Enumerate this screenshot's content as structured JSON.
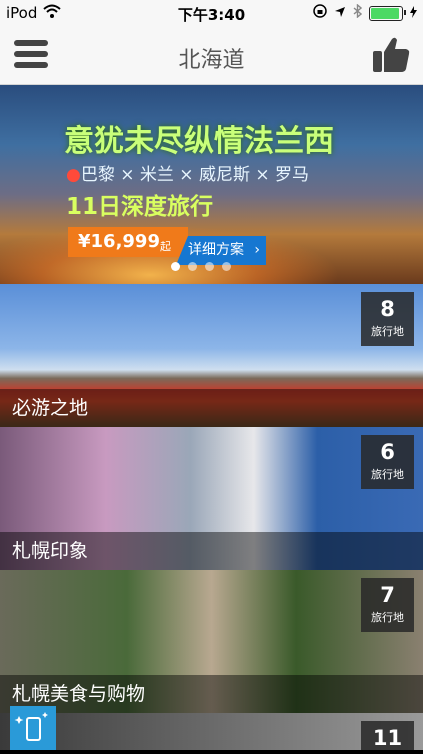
{
  "status": {
    "carrier": "iPod",
    "time": "下午3:40"
  },
  "nav": {
    "title": "北海道"
  },
  "banner": {
    "title": "意犹未尽纵情法兰西",
    "cities": "巴黎 × 米兰 × 威尼斯 × 罗马",
    "days": "11日深度旅行",
    "price": "¥16,999",
    "price_suffix": "起",
    "detail_button": "详细方案",
    "page_count": 4,
    "active_page": 1
  },
  "cards": [
    {
      "title": "必游之地",
      "count": "8",
      "unit": "旅行地"
    },
    {
      "title": "札幌印象",
      "count": "6",
      "unit": "旅行地"
    },
    {
      "title": "札幌美食与购物",
      "count": "7",
      "unit": "旅行地"
    },
    {
      "title": "",
      "count": "11",
      "unit": ""
    }
  ],
  "colors": {
    "accent": "#1677d1",
    "price": "#f07a1a",
    "battery": "#4cd964"
  }
}
